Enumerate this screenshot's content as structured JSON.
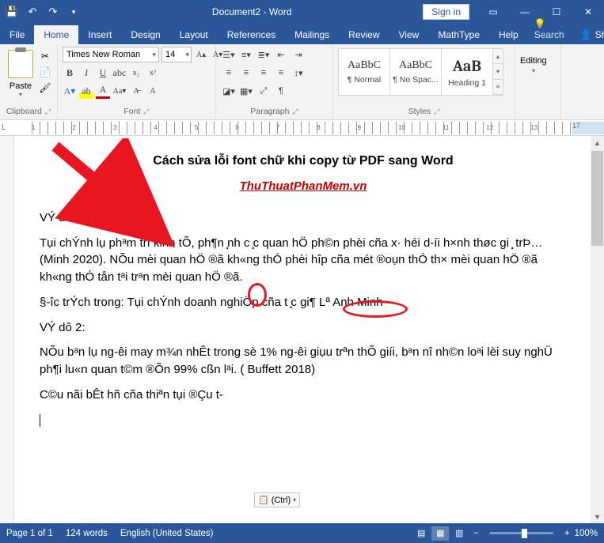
{
  "titlebar": {
    "doc_title": "Document2 - Word",
    "signin": "Sign in"
  },
  "tabs": {
    "items": [
      "File",
      "Home",
      "Insert",
      "Design",
      "Layout",
      "References",
      "Mailings",
      "Review",
      "View",
      "MathType",
      "Help"
    ],
    "active_index": 1,
    "tell_me": "Search",
    "share": "Share"
  },
  "ribbon": {
    "clipboard": {
      "paste": "Paste",
      "label": "Clipboard"
    },
    "font": {
      "name": "Times New Roman",
      "size": "14",
      "label": "Font"
    },
    "paragraph": {
      "label": "Paragraph"
    },
    "styles": {
      "label": "Styles",
      "items": [
        {
          "preview": "AaBbC",
          "label": "¶ Normal"
        },
        {
          "preview": "AaBbC",
          "label": "¶ No Spac..."
        },
        {
          "preview": "AaB",
          "label": "Heading 1"
        }
      ]
    },
    "editing": {
      "label": "Editing"
    }
  },
  "document": {
    "title": "Cách sửa lỗi font chữ khi copy từ PDF sang Word",
    "subtitle": "ThuThuatPhanMem.vn",
    "paragraphs": [
      "VÝ dô 1:",
      "Tụi chÝnh lụ phᵃm trï kinh tÕ, ph¶n ̧nh c ̧c quan hÖ ph©n phèi cña x· héi d-íi h×nh thøc gi ̧ trÞ… (Minh 2020). NÕu mèi quan hÖ ®ã kh«ng thÓ phèi hîp cña mét ®oụn thÓ th× mèi quan hÖ ®ã kh«ng thÓ tån tᵃi trᵃn mèi quan hÖ ®ã.",
      "§-îc trÝch trong: Tụi chÝnh doanh nghiÖp cña t ̧c gi¶ Lª Anh Minh",
      "VÝ dô 2:",
      "NÕu bᵃn lụ ng-êi may m¾n nhÊt trong sè 1% ng-êi giụu trªn thÕ giíi, bᵃn nî nh©n loᵃi lèi suy nghÜ ph¶i lu«n quan t©m ®Õn 99% cßn lᵃi. ( Buffett 2018)",
      "C©u nãi bÊt hñ cña thiªn tụi ®Çu t-"
    ]
  },
  "paste_options": {
    "label": "(Ctrl)"
  },
  "statusbar": {
    "page": "Page 1 of 1",
    "words": "124 words",
    "lang": "English (United States)",
    "zoom": "100%"
  }
}
